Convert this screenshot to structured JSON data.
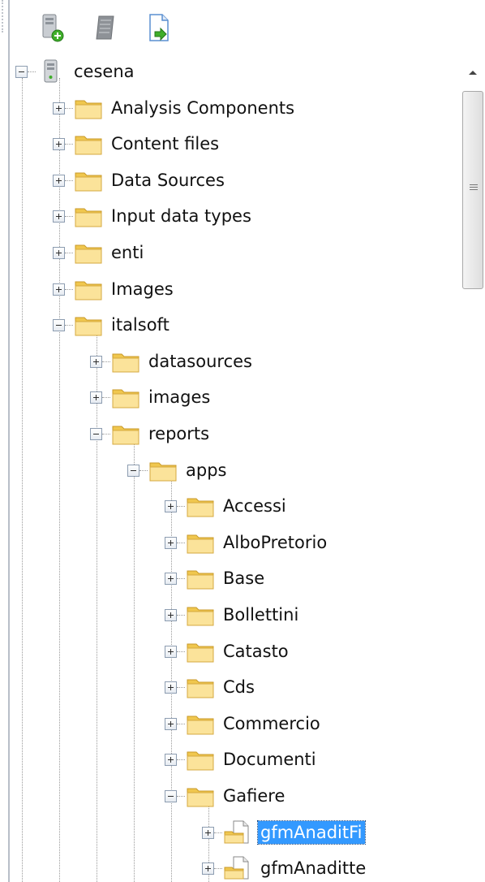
{
  "toolbar": {
    "buttons": [
      {
        "name": "add-server-button",
        "icon": "server-add-icon"
      },
      {
        "name": "scroll-button",
        "icon": "scroll-icon"
      },
      {
        "name": "export-button",
        "icon": "page-export-icon"
      }
    ]
  },
  "tree": {
    "root": {
      "label": "cesena",
      "icon": "server-icon",
      "expanded": true
    },
    "nodes": [
      {
        "label": "Analysis Components",
        "depth": 1,
        "toggle": "plus",
        "icon": "folder"
      },
      {
        "label": "Content files",
        "depth": 1,
        "toggle": "plus",
        "icon": "folder"
      },
      {
        "label": "Data Sources",
        "depth": 1,
        "toggle": "plus",
        "icon": "folder"
      },
      {
        "label": "Input data types",
        "depth": 1,
        "toggle": "plus",
        "icon": "folder"
      },
      {
        "label": "enti",
        "depth": 1,
        "toggle": "plus",
        "icon": "folder"
      },
      {
        "label": "Images",
        "depth": 1,
        "toggle": "plus",
        "icon": "folder"
      },
      {
        "label": "italsoft",
        "depth": 1,
        "toggle": "minus",
        "icon": "folder"
      },
      {
        "label": "datasources",
        "depth": 2,
        "toggle": "plus",
        "icon": "folder"
      },
      {
        "label": "images",
        "depth": 2,
        "toggle": "plus",
        "icon": "folder"
      },
      {
        "label": "reports",
        "depth": 2,
        "toggle": "minus",
        "icon": "folder"
      },
      {
        "label": "apps",
        "depth": 3,
        "toggle": "minus",
        "icon": "folder"
      },
      {
        "label": "Accessi",
        "depth": 4,
        "toggle": "plus",
        "icon": "folder"
      },
      {
        "label": "AlboPretorio",
        "depth": 4,
        "toggle": "plus",
        "icon": "folder"
      },
      {
        "label": "Base",
        "depth": 4,
        "toggle": "plus",
        "icon": "folder"
      },
      {
        "label": "Bollettini",
        "depth": 4,
        "toggle": "plus",
        "icon": "folder"
      },
      {
        "label": "Catasto",
        "depth": 4,
        "toggle": "plus",
        "icon": "folder"
      },
      {
        "label": "Cds",
        "depth": 4,
        "toggle": "plus",
        "icon": "folder"
      },
      {
        "label": "Commercio",
        "depth": 4,
        "toggle": "plus",
        "icon": "folder"
      },
      {
        "label": "Documenti",
        "depth": 4,
        "toggle": "plus",
        "icon": "folder"
      },
      {
        "label": "Gafiere",
        "depth": 4,
        "toggle": "minus",
        "icon": "folder"
      },
      {
        "label": "gfmAnaditFi",
        "depth": 5,
        "toggle": "plus",
        "icon": "report",
        "selected": true
      },
      {
        "label": "gfmAnaditte",
        "depth": 5,
        "toggle": "plus",
        "icon": "report"
      }
    ]
  },
  "scrollbar": {
    "position": 0.0
  },
  "colors": {
    "selection": "#3399ff",
    "folder": "#f7d774",
    "tree_line": "#9a9a9a"
  }
}
